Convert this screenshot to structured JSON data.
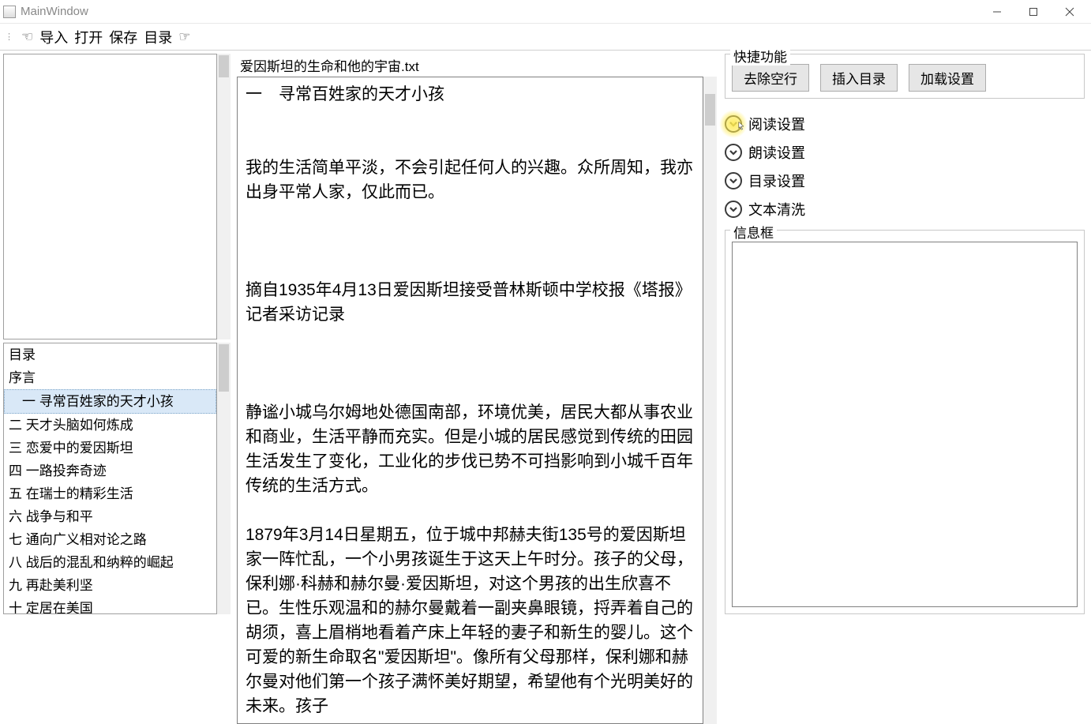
{
  "window": {
    "title": "MainWindow"
  },
  "toolbar": {
    "import": "导入",
    "open": "打开",
    "save": "保存",
    "toc": "目录"
  },
  "toc": {
    "items": [
      "目录",
      "序言",
      "一 寻常百姓家的天才小孩",
      "二 天才头脑如何炼成",
      "三 恋爱中的爱因斯坦",
      "四 一路投奔奇迹",
      "五 在瑞士的精彩生活",
      "六 战争与和平",
      "七 通向广义相对论之路",
      "八 战后的混乱和纳粹的崛起",
      "九 再赴美利坚",
      "十 定居在美国"
    ],
    "selected_index": 2
  },
  "document": {
    "filename": "爱因斯坦的生命和他的宇宙.txt",
    "body": "一　寻常百姓家的天才小孩\n\n\n我的生活简单平淡，不会引起任何人的兴趣。众所周知，我亦出身平常人家，仅此而已。\n\n\n\n摘自1935年4月13日爱因斯坦接受普林斯顿中学校报《塔报》记者采访记录\n\n\n\n静谧小城乌尔姆地处德国南部，环境优美，居民大都从事农业和商业，生活平静而充实。但是小城的居民感觉到传统的田园生活发生了变化，工业化的步伐已势不可挡影响到小城千百年传统的生活方式。\n\n1879年3月14日星期五，位于城中邦赫夫街135号的爱因斯坦家一阵忙乱，一个小男孩诞生于这天上午时分。孩子的父母，保利娜·科赫和赫尔曼·爱因斯坦，对这个男孩的出生欣喜不已。生性乐观温和的赫尔曼戴着一副夹鼻眼镜，捋弄着自己的胡须，喜上眉梢地看着产床上年轻的妻子和新生的婴儿。这个可爱的新生命取名\"爱因斯坦\"。像所有父母那样，保利娜和赫尔曼对他们第一个孩子满怀美好期望，希望他有个光明美好的未来。孩子"
  },
  "quick": {
    "legend": "快捷功能",
    "btn_remove_blank": "去除空行",
    "btn_insert_toc": "插入目录",
    "btn_load_settings": "加载设置"
  },
  "accordion": {
    "read_settings": "阅读设置",
    "speak_settings": "朗读设置",
    "toc_settings": "目录设置",
    "text_clean": "文本清洗"
  },
  "info": {
    "legend": "信息框"
  }
}
